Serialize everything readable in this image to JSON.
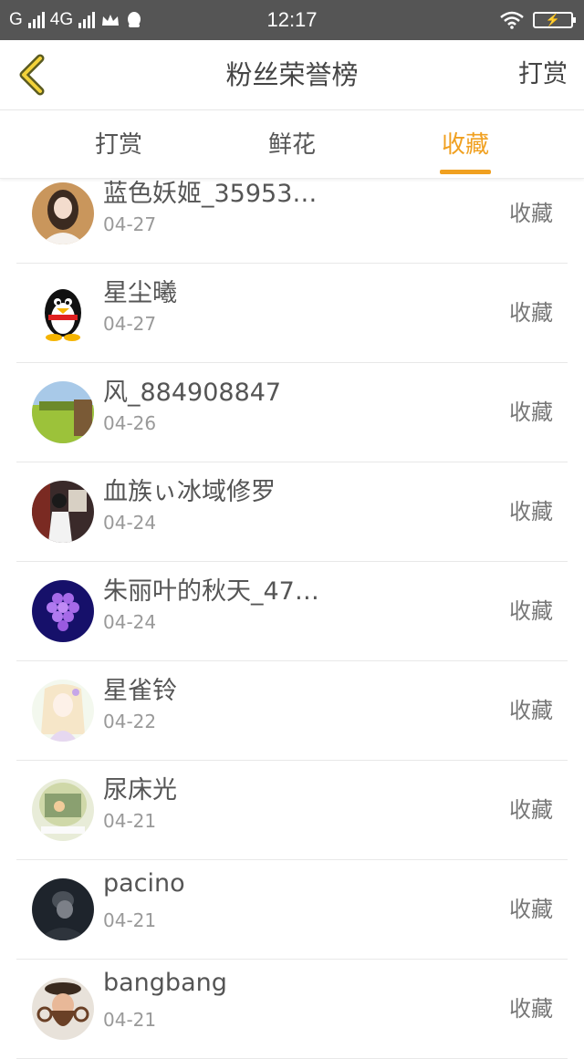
{
  "status_bar": {
    "carrier": "G",
    "network": "4G",
    "time": "12:17"
  },
  "header": {
    "title": "粉丝荣誉榜",
    "action": "打赏"
  },
  "tabs": [
    {
      "label": "打赏",
      "active": false
    },
    {
      "label": "鲜花",
      "active": false
    },
    {
      "label": "收藏",
      "active": true
    }
  ],
  "colors": {
    "accent": "#f0a020",
    "status_bar": "#555555"
  },
  "items": [
    {
      "name": "蓝色妖姬_35953…",
      "date": "04-27",
      "action": "收藏",
      "avatar": "woman-photo"
    },
    {
      "name": "星尘曦",
      "date": "04-27",
      "action": "收藏",
      "avatar": "qq-penguin"
    },
    {
      "name": "风_884908847",
      "date": "04-26",
      "action": "收藏",
      "avatar": "grass-field"
    },
    {
      "name": "血族ぃ冰域修罗",
      "date": "04-24",
      "action": "收藏",
      "avatar": "person-dark"
    },
    {
      "name": "朱丽叶的秋天_47…",
      "date": "04-24",
      "action": "收藏",
      "avatar": "purple-grapes"
    },
    {
      "name": "星雀铃",
      "date": "04-22",
      "action": "收藏",
      "avatar": "anime-girl"
    },
    {
      "name": "尿床光",
      "date": "04-21",
      "action": "收藏",
      "avatar": "cartoon-room"
    },
    {
      "name": "pacino",
      "date": "04-21",
      "action": "收藏",
      "avatar": "man-dark"
    },
    {
      "name": "bangbang",
      "date": "04-21",
      "action": "收藏",
      "avatar": "bearded-man"
    }
  ]
}
